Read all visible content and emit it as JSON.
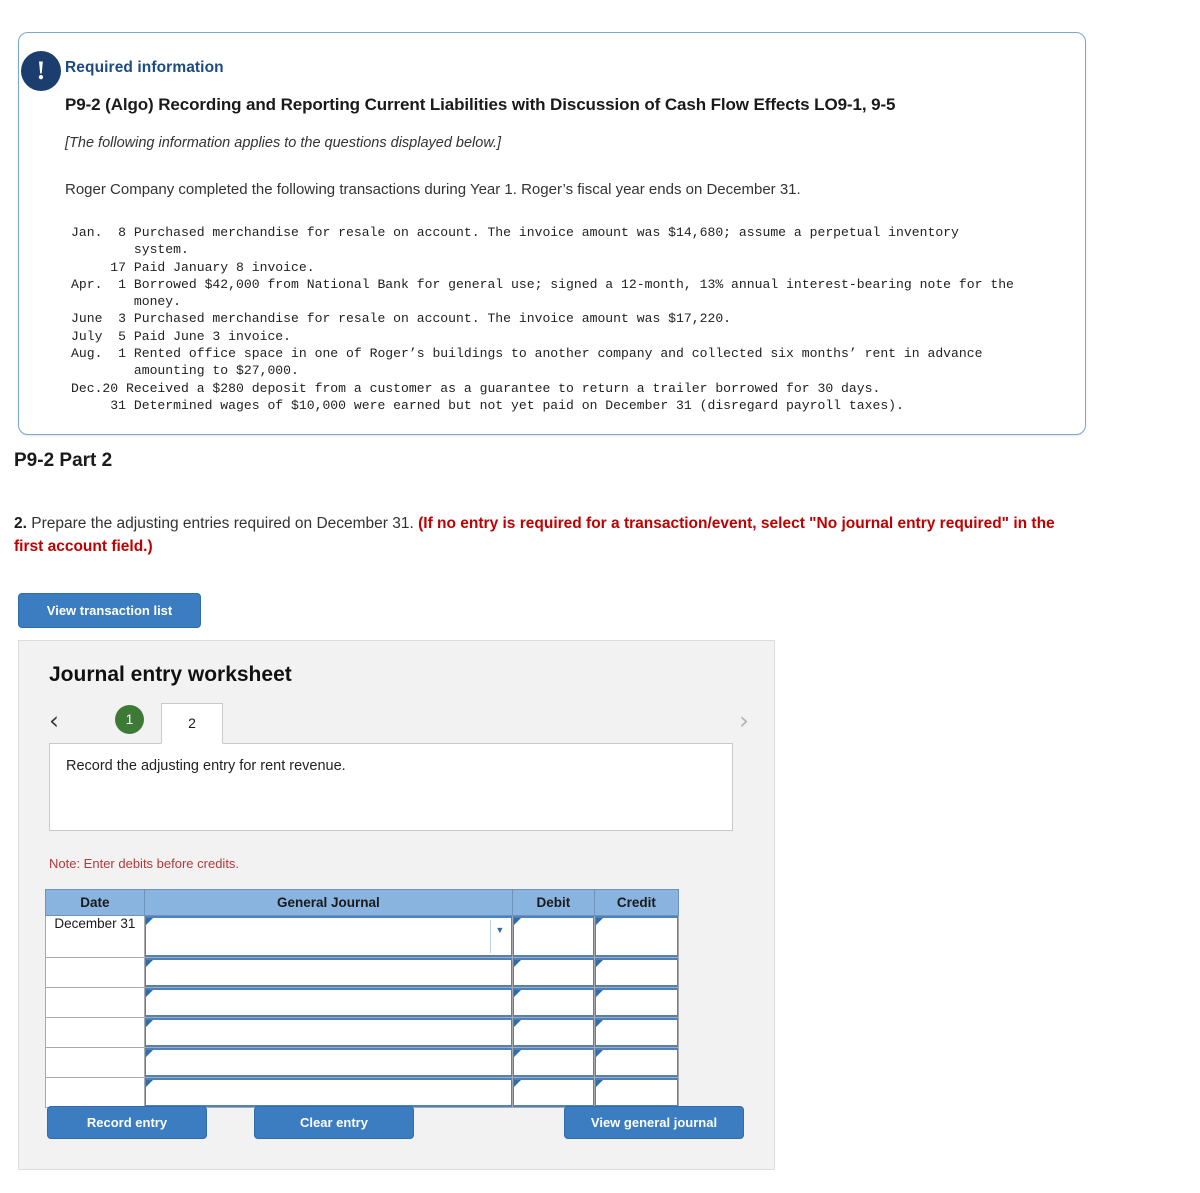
{
  "callout": {
    "icon": "exclamation-icon",
    "required_label": "Required information",
    "problem_title": "P9-2 (Algo) Recording and Reporting Current Liabilities with Discussion of Cash Flow Effects LO9-1, 9-5",
    "applies_note": "[The following information applies to the questions displayed below.]",
    "intro": "Roger Company completed the following transactions during Year 1. Roger’s fiscal year ends on December 31.",
    "transactions": "Jan.  8 Purchased merchandise for resale on account. The invoice amount was $14,680; assume a perpetual inventory\n        system.\n     17 Paid January 8 invoice.\nApr.  1 Borrowed $42,000 from National Bank for general use; signed a 12-month, 13% annual interest-bearing note for the\n        money.\nJune  3 Purchased merchandise for resale on account. The invoice amount was $17,220.\nJuly  5 Paid June 3 invoice.\nAug.  1 Rented office space in one of Roger’s buildings to another company and collected six months’ rent in advance\n        amounting to $27,000.\nDec.20 Received a $280 deposit from a customer as a guarantee to return a trailer borrowed for 30 days.\n     31 Determined wages of $10,000 were earned but not yet paid on December 31 (disregard payroll taxes)."
  },
  "part": {
    "heading": "P9-2 Part 2",
    "question_number": "2.",
    "question_text": " Prepare the adjusting entries required on December 31. ",
    "question_emphasis": "(If no entry is required for a transaction/event, select \"No journal entry required\" in the first account field.)"
  },
  "buttons": {
    "view_transaction_list": "View transaction list",
    "record_entry": "Record entry",
    "clear_entry": "Clear entry",
    "view_general_journal": "View general journal"
  },
  "worksheet": {
    "title": "Journal entry worksheet",
    "prev_icon": "chevron-left-icon",
    "next_icon": "chevron-right-icon",
    "tabs": [
      {
        "label": "1",
        "state": "completed"
      },
      {
        "label": "2",
        "state": "active"
      }
    ],
    "prompt": "Record the adjusting entry for rent revenue.",
    "note": "Note: Enter debits before credits.",
    "table": {
      "headers": [
        "Date",
        "General Journal",
        "Debit",
        "Credit"
      ],
      "rows": [
        {
          "date": "December 31",
          "general_journal": "",
          "debit": "",
          "credit": "",
          "has_dropdown": true
        },
        {
          "date": "",
          "general_journal": "",
          "debit": "",
          "credit": "",
          "has_dropdown": false
        },
        {
          "date": "",
          "general_journal": "",
          "debit": "",
          "credit": "",
          "has_dropdown": false
        },
        {
          "date": "",
          "general_journal": "",
          "debit": "",
          "credit": "",
          "has_dropdown": false
        },
        {
          "date": "",
          "general_journal": "",
          "debit": "",
          "credit": "",
          "has_dropdown": false
        },
        {
          "date": "",
          "general_journal": "",
          "debit": "",
          "credit": "",
          "has_dropdown": false
        }
      ]
    }
  },
  "colors": {
    "accent_blue": "#3b7dc0",
    "callout_border": "#7aa7d0",
    "badge_navy": "#1b3e6f",
    "tab_green": "#3c7a35",
    "header_blue": "#89b4e0",
    "note_red": "#b23a3a",
    "emphasis_red": "#c00000",
    "required_label_blue": "#1b4a85"
  }
}
